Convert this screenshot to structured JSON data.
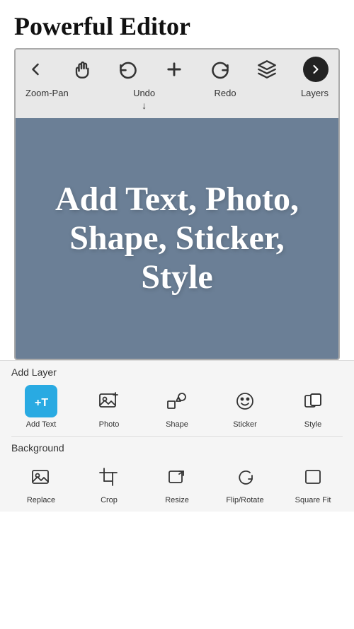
{
  "header": {
    "title": "Powerful Editor"
  },
  "toolbar": {
    "icons": [
      {
        "name": "back",
        "symbol": "←"
      },
      {
        "name": "zoom-pan",
        "symbol": "☛"
      },
      {
        "name": "undo",
        "symbol": "↩"
      },
      {
        "name": "add",
        "symbol": "+"
      },
      {
        "name": "redo",
        "symbol": "↪"
      },
      {
        "name": "layers",
        "symbol": "◈"
      },
      {
        "name": "next",
        "symbol": "→"
      }
    ],
    "labels": {
      "zoom_pan": "Zoom-Pan",
      "undo": "Undo",
      "redo": "Redo",
      "layers": "Layers",
      "arrow": "↓"
    }
  },
  "canvas": {
    "text": "Add Text, Photo, Shape, Sticker, Style"
  },
  "add_layer_section": {
    "label": "Add Layer",
    "tools": [
      {
        "name": "add-text",
        "label": "Add Text",
        "active": true
      },
      {
        "name": "photo",
        "label": "Photo",
        "active": false
      },
      {
        "name": "shape",
        "label": "Shape",
        "active": false
      },
      {
        "name": "sticker",
        "label": "Sticker",
        "active": false
      },
      {
        "name": "style",
        "label": "Style",
        "active": false
      }
    ]
  },
  "background_section": {
    "label": "Background",
    "tools": [
      {
        "name": "replace",
        "label": "Replace",
        "active": false
      },
      {
        "name": "crop",
        "label": "Crop",
        "active": false
      },
      {
        "name": "resize",
        "label": "Resize",
        "active": false
      },
      {
        "name": "flip-rotate",
        "label": "Flip/Rotate",
        "active": false
      },
      {
        "name": "square-fit",
        "label": "Square Fit",
        "active": false
      }
    ]
  }
}
